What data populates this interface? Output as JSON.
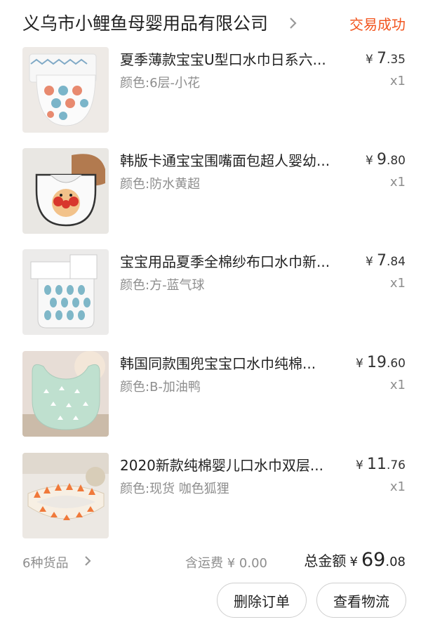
{
  "header": {
    "shop_name": "义乌市小鲤鱼母婴用品有限公司",
    "status": "交易成功"
  },
  "items": [
    {
      "title": "夏季薄款宝宝U型口水巾日系六...",
      "variant": "颜色:6层-小花",
      "currency": "¥",
      "price_int": "7",
      "price_dec": ".35",
      "qty": "x1",
      "thumb_icon": "flower-bib-image"
    },
    {
      "title": "韩版卡通宝宝围嘴面包超人婴幼...",
      "variant": "颜色:防水黄超",
      "currency": "¥",
      "price_int": "9",
      "price_dec": ".80",
      "qty": "x1",
      "thumb_icon": "anpanman-bib-image"
    },
    {
      "title": "宝宝用品夏季全棉纱布口水巾新...",
      "variant": "颜色:方-蓝气球",
      "currency": "¥",
      "price_int": "7",
      "price_dec": ".84",
      "qty": "x1",
      "thumb_icon": "balloon-bib-image"
    },
    {
      "title": "韩国同款围兜宝宝口水巾纯棉...",
      "variant": "颜色:B-加油鸭",
      "currency": "¥",
      "price_int": "19",
      "price_dec": ".60",
      "qty": "x1",
      "thumb_icon": "duck-bib-image"
    },
    {
      "title": "2020新款纯棉婴儿口水巾双层...",
      "variant": "颜色:现货 咖色狐狸",
      "currency": "¥",
      "price_int": "11",
      "price_dec": ".76",
      "qty": "x1",
      "thumb_icon": "fox-bib-image"
    }
  ],
  "summary": {
    "kinds": "6种货品",
    "freight": "含运费 ¥ 0.00",
    "total_label": "总金额",
    "currency": "¥",
    "total_int": "69",
    "total_dec": ".08"
  },
  "actions": {
    "delete_order": "删除订单",
    "view_logistics": "查看物流"
  },
  "colors": {
    "status": "#f2551f",
    "muted": "#8e8e8e",
    "text": "#222222"
  }
}
